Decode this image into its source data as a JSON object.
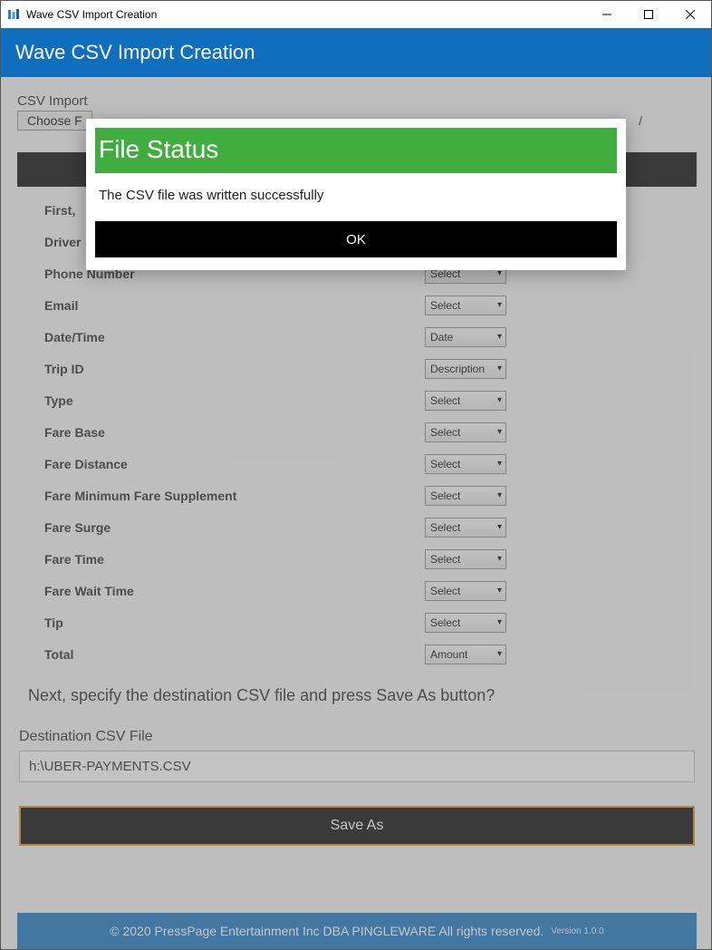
{
  "window": {
    "title": "Wave CSV Import Creation"
  },
  "header": {
    "title": "Wave CSV Import Creation"
  },
  "import": {
    "label": "CSV Import",
    "choose_label": "Choose F",
    "file_name_tail": "/"
  },
  "black_bar": "",
  "instruction1_prefix": "First, ",
  "fields": [
    {
      "label": "Driver",
      "value": ""
    },
    {
      "label": "Phone Number",
      "value": "Select"
    },
    {
      "label": "Email",
      "value": "Select"
    },
    {
      "label": "Date/Time",
      "value": "Date"
    },
    {
      "label": "Trip ID",
      "value": "Description"
    },
    {
      "label": "Type",
      "value": "Select"
    },
    {
      "label": "Fare Base",
      "value": "Select"
    },
    {
      "label": "Fare Distance",
      "value": "Select"
    },
    {
      "label": "Fare Minimum Fare Supplement",
      "value": "Select"
    },
    {
      "label": "Fare Surge",
      "value": "Select"
    },
    {
      "label": "Fare Time",
      "value": "Select"
    },
    {
      "label": "Fare Wait Time",
      "value": "Select"
    },
    {
      "label": "Tip",
      "value": "Select"
    },
    {
      "label": "Total",
      "value": "Amount"
    }
  ],
  "instruction2": "Next, specify the destination CSV file and press Save As button?",
  "destination": {
    "label": "Destination CSV File",
    "value": "h:\\UBER-PAYMENTS.CSV"
  },
  "save_as_label": "Save As",
  "footer": {
    "copyright": "© 2020 PressPage Entertainment Inc DBA PINGLEWARE  All rights reserved.",
    "version": "Version 1.0.0"
  },
  "modal": {
    "title": "File Status",
    "message": "The CSV file was written successfully",
    "ok": "OK"
  }
}
